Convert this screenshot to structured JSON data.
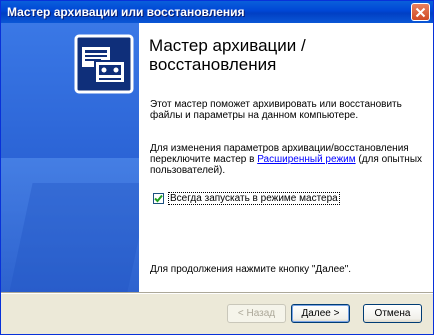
{
  "window": {
    "title": "Мастер архивации или восстановления"
  },
  "wizard": {
    "title": "Мастер архивации / восстановления",
    "intro": "Этот мастер поможет архивировать или восстановить файлы и параметры на данном компьютере.",
    "advanced_text_before": "Для изменения параметров архивации/восстановления переключите мастер в ",
    "advanced_link": "Расширенный режим",
    "advanced_text_after": " (для опытных пользователей).",
    "checkbox_label": "Всегда запускать в режиме мастера",
    "checkbox_checked": true,
    "continue_text": "Для продолжения нажмите кнопку \"Далее\"."
  },
  "buttons": {
    "back": "< Назад",
    "next": "Далее >",
    "cancel": "Отмена"
  },
  "colors": {
    "titlebar": "#0054e3",
    "sidebar": "#2a62d4",
    "link": "#0000ff"
  }
}
